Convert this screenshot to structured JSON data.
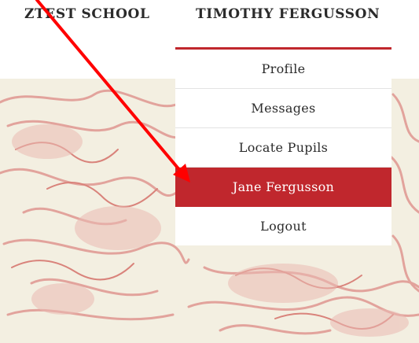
{
  "header": {
    "school_name": "ZTEST SCHOOL",
    "user_name": "TIMOTHY FERGUSSON"
  },
  "menu": {
    "items": [
      {
        "label": "Profile"
      },
      {
        "label": "Messages"
      },
      {
        "label": "Locate Pupils"
      },
      {
        "label": "Jane Fergusson",
        "active": true
      },
      {
        "label": "Logout"
      }
    ]
  },
  "colors": {
    "accent": "#c0272d",
    "text": "#2b2b2b",
    "background_art": "#e8a59f",
    "annotation_arrow": "#ff0000"
  }
}
